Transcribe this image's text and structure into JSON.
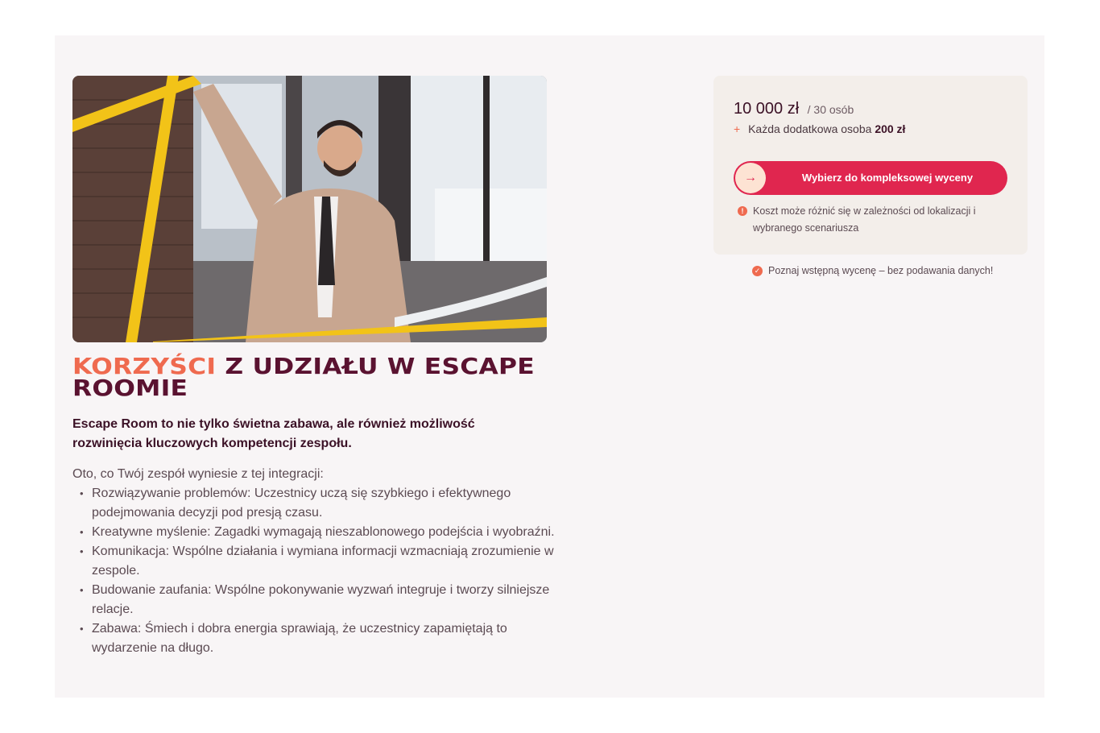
{
  "hero": {
    "image_description_icon": "photo-detective-crime-tape"
  },
  "headline": {
    "accent": "KORZYŚCI",
    "rest": "Z UDZIAŁU W ESCAPE ROOMIE"
  },
  "lead": "Escape Room to nie tylko świetna zabawa, ale również możliwość rozwinięcia kluczowych kompetencji zespołu.",
  "intro": "Oto, co Twój zespół wyniesie z tej integracji:",
  "benefits": [
    "Rozwiązywanie problemów: Uczestnicy uczą się szybkiego i efektywnego podejmowania decyzji pod presją czasu.",
    "Kreatywne myślenie: Zagadki wymagają nieszablonowego podejścia i wyobraźni.",
    "Komunikacja: Wspólne działania i wymiana informacji wzmacniają zrozumienie w zespole.",
    "Budowanie zaufania: Wspólne pokonywanie wyzwań integruje i tworzy silniejsze relacje.",
    "Zabawa: Śmiech i dobra energia sprawiają, że uczestnicy zapamiętają to wydarzenie na długo."
  ],
  "card": {
    "price": "10 000 zł",
    "price_unit": "/ 30 osób",
    "extra_label": "Każda dodatkowa osoba",
    "extra_price": "200 zł",
    "cta_label": "Wybierz do kompleksowej wyceny",
    "cta_icon": "arrow-right-icon",
    "note": "Koszt może różnić się w zależności od lokalizacji i wybranego scenariusza"
  },
  "quick_quote": "Poznaj wstępną wycenę – bez podawania danych!",
  "colors": {
    "accent_orange": "#ef6a4f",
    "brand_dark": "#5a1230",
    "cta_red": "#e0264f",
    "card_bg": "#f3eeea",
    "panel_bg": "#f8f5f6"
  }
}
